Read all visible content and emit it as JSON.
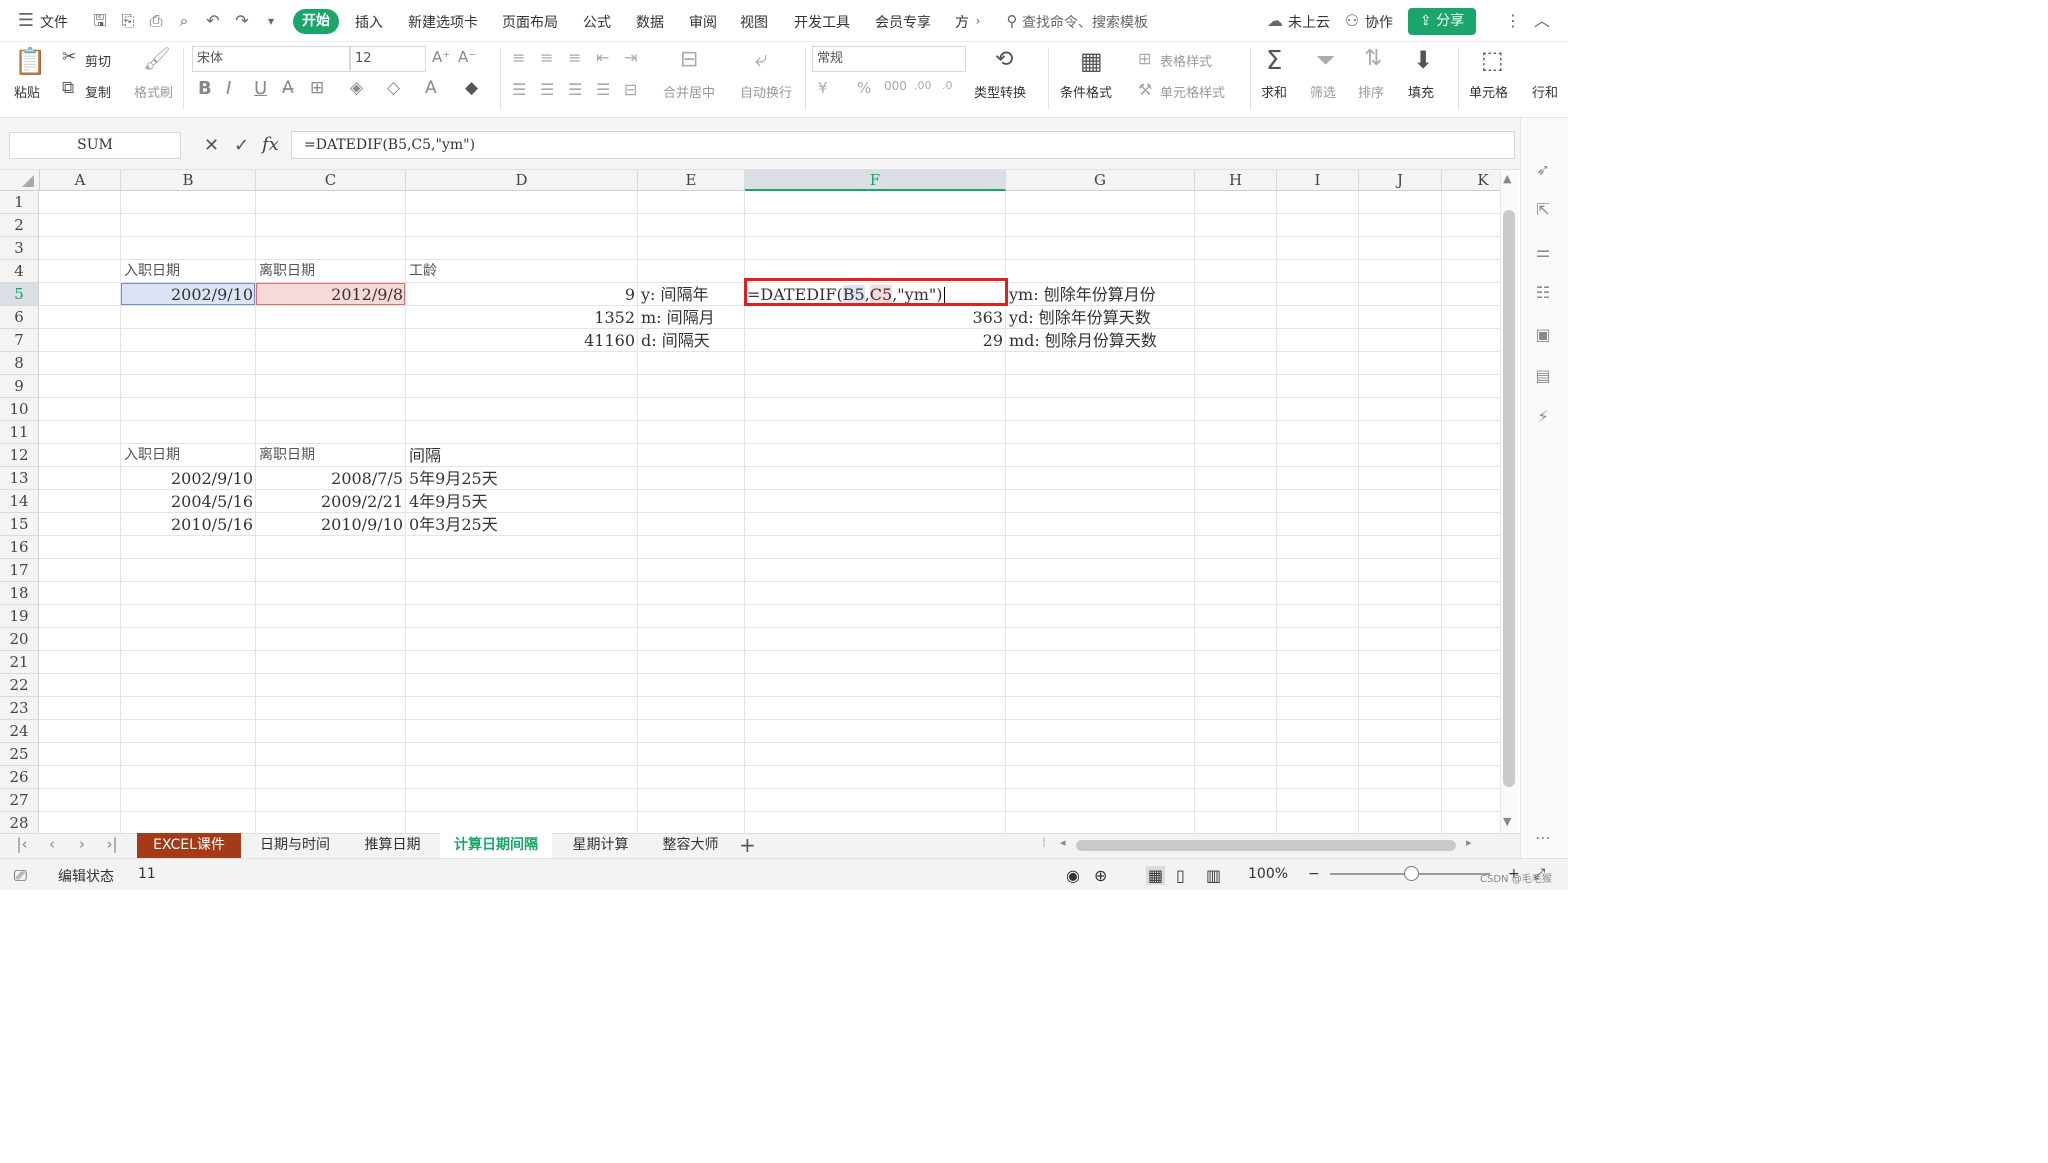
{
  "menubar": {
    "file_label": "文件",
    "menus": [
      "开始",
      "插入",
      "新建选项卡",
      "页面布局",
      "公式",
      "数据",
      "审阅",
      "视图",
      "开发工具",
      "会员专享",
      "方"
    ],
    "search_placeholder": "查找命令、搜索模板",
    "cloud_label": "未上云",
    "collab_label": "协作",
    "share_label": "分享"
  },
  "ribbon": {
    "paste": "粘贴",
    "cut": "剪切",
    "copy": "复制",
    "format_painter": "格式刷",
    "font_name": "宋体",
    "font_size": "12",
    "merge_center": "合并居中",
    "wrap_text": "自动换行",
    "number_format": "常规",
    "type_convert": "类型转换",
    "cond_format": "条件格式",
    "table_style": "表格样式",
    "cell_style": "单元格样式",
    "sum": "求和",
    "filter": "筛选",
    "sort": "排序",
    "fill": "填充",
    "cell": "单元格",
    "row_col": "行和"
  },
  "formula_bar": {
    "name_box": "SUM",
    "fx": "fx",
    "formula": "=DATEDIF(B5,C5,\"ym\")"
  },
  "columns": [
    "A",
    "B",
    "C",
    "D",
    "E",
    "F",
    "G",
    "H",
    "I",
    "J",
    "K"
  ],
  "selected_column": "F",
  "selected_row": 5,
  "cells": {
    "B4": "入职日期",
    "C4": "离职日期",
    "D4": "工龄",
    "B5": "2002/9/10",
    "C5": "2012/9/8",
    "D5": "9",
    "E5": "y: 间隔年",
    "F5_prefix": "=DATEDIF(",
    "F5_ref1": "B5",
    "F5_comma1": ",",
    "F5_ref2": "C5",
    "F5_tail": ",\"ym\")",
    "G5": "ym: 刨除年份算月份",
    "D6": "1352",
    "E6": "m: 间隔月",
    "F6": "363",
    "G6": "yd: 刨除年份算天数",
    "D7": "41160",
    "E7": "d: 间隔天",
    "F7": "29",
    "G7": "md: 刨除月份算天数",
    "B12": "入职日期",
    "C12": "离职日期",
    "D12": "间隔",
    "B13": "2002/9/10",
    "C13": "2008/7/5",
    "D13": "5年9月25天",
    "B14": "2004/5/16",
    "C14": "2009/2/21",
    "D14": "4年9月5天",
    "B15": "2010/5/16",
    "C15": "2010/9/10",
    "D15": "0年3月25天"
  },
  "sheets": [
    "EXCEL课件",
    "日期与时间",
    "推算日期",
    "计算日期间隔",
    "星期计算",
    "整容大师"
  ],
  "active_sheet": "计算日期间隔",
  "status": {
    "mode": "编辑状态",
    "count": "11",
    "zoom": "100%",
    "watermark": "CSDN @毛毛猴"
  },
  "colors": {
    "accent": "#1aa56b",
    "highlight_box": "#e02020",
    "ref1_fill": "#dbe3f4",
    "ref2_fill": "#f6dada",
    "first_tab": "#a33b18"
  }
}
